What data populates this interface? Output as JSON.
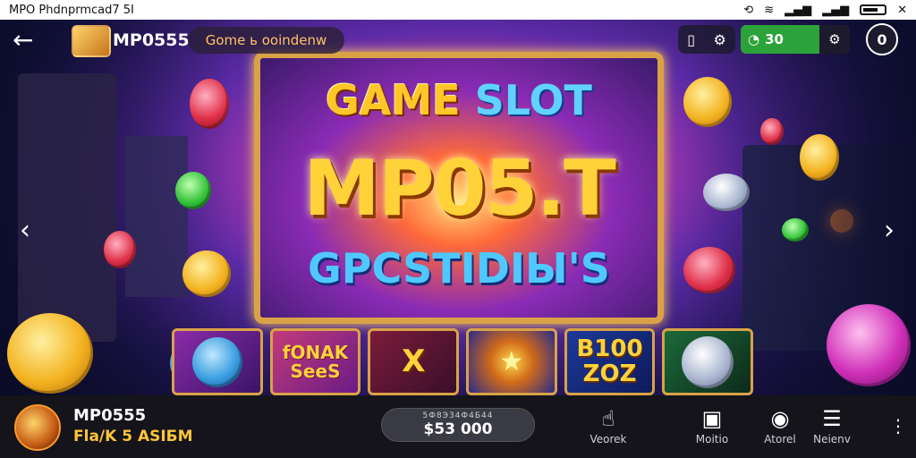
{
  "statusbar": {
    "title": "MPO Phdnprmcad7 5I"
  },
  "topbar": {
    "brand": "MP0555",
    "promo": "Gome ь ooindenw",
    "balance": "30",
    "menu_label": "0"
  },
  "banner": {
    "word1": "GAME",
    "word2": "SLOT",
    "title": "MP05.T",
    "subtitle": "GPCSTIDIЫ'S"
  },
  "cards": [
    {
      "label": ""
    },
    {
      "label": "fONAK SeeS"
    },
    {
      "label": "X"
    },
    {
      "label": ""
    },
    {
      "label": "B100 ZOZ"
    },
    {
      "label": ""
    }
  ],
  "bottombar": {
    "app_name": "MP0555",
    "app_tag": "Fla/K 5 ASIБM",
    "pill_label": "5Ф8Э34Ф4Б44",
    "pill_value": "$53 000",
    "nav": [
      {
        "label": "Veorek",
        "icon": "hand-icon"
      },
      {
        "label": "Moitio",
        "icon": "slot-icon"
      },
      {
        "label": "Atorel",
        "icon": "profile-icon"
      },
      {
        "label": "Neienv",
        "icon": "chat-icon"
      }
    ]
  },
  "colors": {
    "accent_green": "#2ca33a",
    "gold": "#d9a247",
    "bar": "#14141a"
  }
}
